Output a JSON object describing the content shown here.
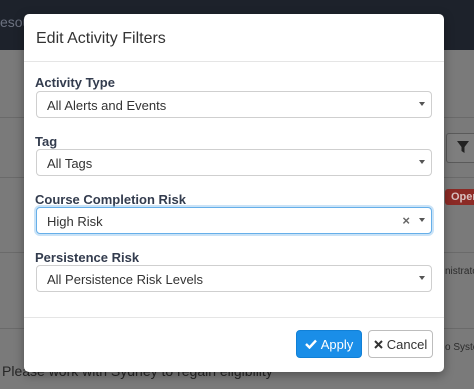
{
  "background": {
    "top_fragment": "esou",
    "badge": "Oper",
    "side_text_1": "nistrato",
    "side_text_2": "o Syster",
    "bottom_text": "Please work with Sydney to regain eligibility"
  },
  "modal": {
    "title": "Edit Activity Filters",
    "fields": [
      {
        "label": "Activity Type",
        "value": "All Alerts and Events"
      },
      {
        "label": "Tag",
        "value": "All Tags"
      },
      {
        "label": "Course Completion Risk",
        "value": "High Risk"
      },
      {
        "label": "Persistence Risk",
        "value": "All Persistence Risk Levels"
      }
    ],
    "apply_label": "Apply",
    "cancel_label": "Cancel"
  },
  "colors": {
    "primary": "#1a8ee8",
    "label": "#333c4e",
    "focus_border": "#66afe9",
    "danger_badge": "#8c2a25"
  },
  "icons": {
    "apply": "check-icon",
    "cancel": "close-icon",
    "filter": "filter-icon",
    "clear": "clear-selection-icon",
    "dropdown": "caret-down-icon"
  }
}
